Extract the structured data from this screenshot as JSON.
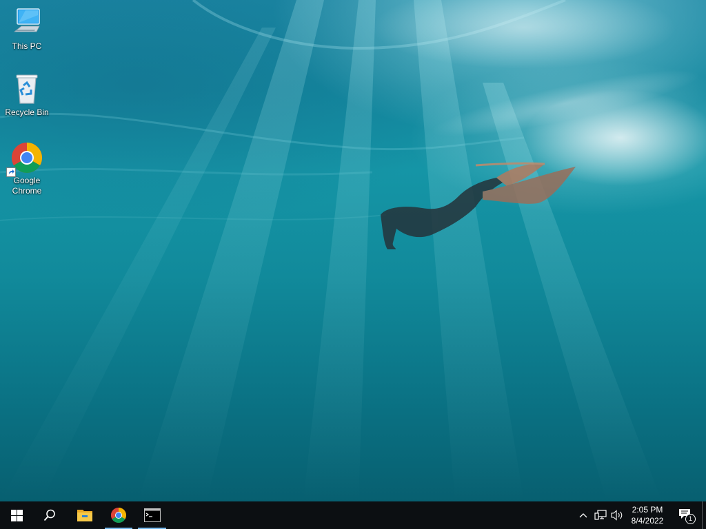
{
  "desktop": {
    "icons": [
      {
        "label": "This PC",
        "icon": "this-pc-icon"
      },
      {
        "label": "Recycle Bin",
        "icon": "recycle-bin-icon"
      },
      {
        "label": "Google Chrome",
        "icon": "google-chrome-icon",
        "shortcut": true
      }
    ]
  },
  "taskbar": {
    "start": {
      "icon": "windows-logo-icon"
    },
    "search": {
      "icon": "search-icon"
    },
    "apps": [
      {
        "name": "File Explorer",
        "icon": "file-explorer-icon",
        "running": false
      },
      {
        "name": "Google Chrome",
        "icon": "google-chrome-icon",
        "running": true
      },
      {
        "name": "Command Prompt",
        "icon": "command-prompt-icon",
        "running": true
      }
    ],
    "tray": {
      "icons": [
        "chevron-up-icon",
        "network-icon",
        "volume-icon"
      ],
      "time": "2:05 PM",
      "date": "8/4/2022",
      "notifications": {
        "icon": "action-center-icon",
        "count": "1"
      }
    }
  },
  "colors": {
    "taskbar_bg": "#0c0f12",
    "running_indicator": "#76b9ed",
    "water": "#1595a6"
  }
}
